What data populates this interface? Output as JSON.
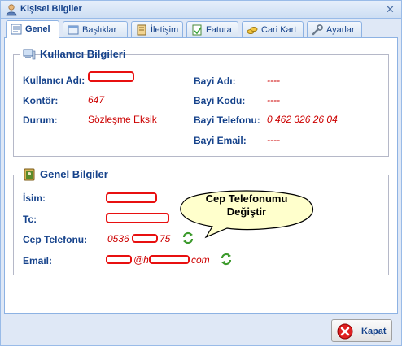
{
  "window": {
    "title": "Kişisel Bilgiler",
    "close_glyph": "✕"
  },
  "tabs": [
    {
      "label": "Genel",
      "icon": "form-icon",
      "active": true
    },
    {
      "label": "Başlıklar",
      "icon": "header-icon"
    },
    {
      "label": "İletişim",
      "icon": "contact-icon"
    },
    {
      "label": "Fatura",
      "icon": "invoice-icon"
    },
    {
      "label": "Cari Kart",
      "icon": "coins-icon"
    },
    {
      "label": "Ayarlar",
      "icon": "wrench-icon"
    }
  ],
  "user_info": {
    "legend": "Kullanıcı Bilgileri",
    "left": [
      {
        "label": "Kullanıcı Adı:",
        "value": ""
      },
      {
        "label": "Kontör:",
        "value": "647"
      },
      {
        "label": "Durum:",
        "value": "Sözleşme Eksik"
      }
    ],
    "right": [
      {
        "label": "Bayi Adı:",
        "value": "----"
      },
      {
        "label": "Bayi Kodu:",
        "value": "----"
      },
      {
        "label": "Bayi Telefonu:",
        "value": "0 462 326 26 04"
      },
      {
        "label": "Bayi Email:",
        "value": "----"
      }
    ]
  },
  "general_info": {
    "legend": "Genel Bilgiler",
    "rows": [
      {
        "label": "İsim:",
        "value": ""
      },
      {
        "label": "Tc:",
        "value": ""
      },
      {
        "label": "Cep Telefonu:",
        "value_prefix": "0536",
        "value_suffix": "75"
      },
      {
        "label": "Email:",
        "value_at": "@h",
        "value_suffix": "com"
      }
    ]
  },
  "callout": {
    "line1": "Cep Telefonumu",
    "line2": "Değiştir"
  },
  "footer": {
    "close_label": "Kapat"
  },
  "colors": {
    "accent": "#15428b",
    "value_red": "#cc0000",
    "redaction": "#e81010",
    "border": "#99bbe8"
  }
}
